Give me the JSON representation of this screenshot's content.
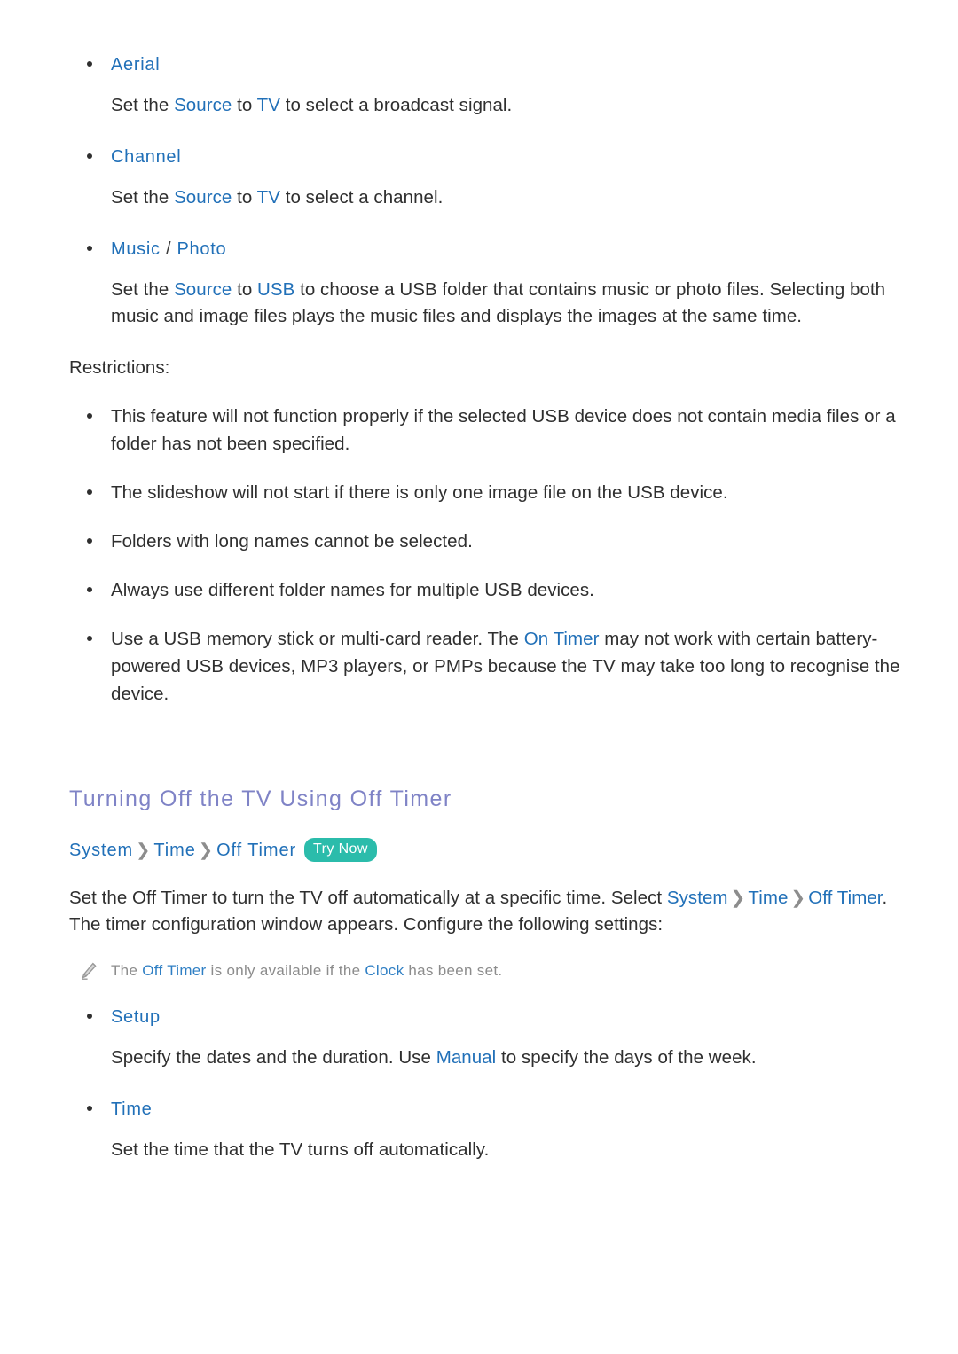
{
  "document": {
    "type": "tv-e-manual-page",
    "background_color": "#ffffff",
    "accent_blue": "#2170b8",
    "heading_purple": "#7f83c6",
    "badge_teal": "#2bbcab",
    "body_text_color": "#2f2f2f",
    "note_text_color": "#8c8c8c"
  },
  "source_options": {
    "items": [
      {
        "title": "Aerial",
        "body_prefix": "Set the ",
        "kw1": "Source",
        "body_mid": " to ",
        "kw2": "TV",
        "body_suffix": " to select a broadcast signal."
      },
      {
        "title": "Channel",
        "body_prefix": "Set the ",
        "kw1": "Source",
        "body_mid": " to ",
        "kw2": "TV",
        "body_suffix": " to select a channel."
      }
    ],
    "music_photo": {
      "title_part1": "Music",
      "title_separator": " / ",
      "title_part2": "Photo",
      "body_prefix": "Set the ",
      "kw1": "Source",
      "body_mid": " to ",
      "kw2": "USB",
      "body_suffix": " to choose a USB folder that contains music or photo files. Selecting both music and image files plays the music files and displays the images at the same time."
    }
  },
  "restrictions": {
    "label": "Restrictions:",
    "items": [
      {
        "text": "This feature will not function properly if the selected USB device does not contain media files or a folder has not been specified."
      },
      {
        "text": "The slideshow will not start if there is only one image file on the USB device."
      },
      {
        "text": "Folders with long names cannot be selected."
      },
      {
        "text": "Always use different folder names for multiple USB devices."
      },
      {
        "text_prefix": "Use a USB memory stick or multi-card reader. The ",
        "kw": "On Timer",
        "text_suffix": " may not work with certain battery-powered USB devices, MP3 players, or PMPs because the TV may take too long to recognise the device."
      }
    ]
  },
  "off_timer_section": {
    "heading": "Turning Off the TV Using Off Timer",
    "breadcrumb": {
      "crumb1": "System",
      "chevron1": "❯",
      "crumb2": "Time",
      "chevron2": "❯",
      "crumb3": "Off Timer",
      "badge": "Try Now"
    },
    "intro": {
      "prefix": "Set the Off Timer to turn the TV off automatically at a specific time. Select ",
      "kw1": "System",
      "chev1": "❯",
      "kw2": "Time",
      "chev2": "❯",
      "kw3": "Off Timer",
      "suffix": ". The timer configuration window appears. Configure the following settings:"
    },
    "note": {
      "icon": "pencil-icon",
      "prefix": "The ",
      "kw1": "Off Timer",
      "mid": " is only available if the ",
      "kw2": "Clock",
      "suffix": " has been set."
    },
    "settings": [
      {
        "title": "Setup",
        "body_prefix": "Specify the dates and the duration. Use ",
        "kw": "Manual",
        "body_suffix": " to specify the days of the week."
      },
      {
        "title": "Time",
        "body_prefix": "Set the time that the TV turns off automatically.",
        "kw": "",
        "body_suffix": ""
      }
    ]
  }
}
